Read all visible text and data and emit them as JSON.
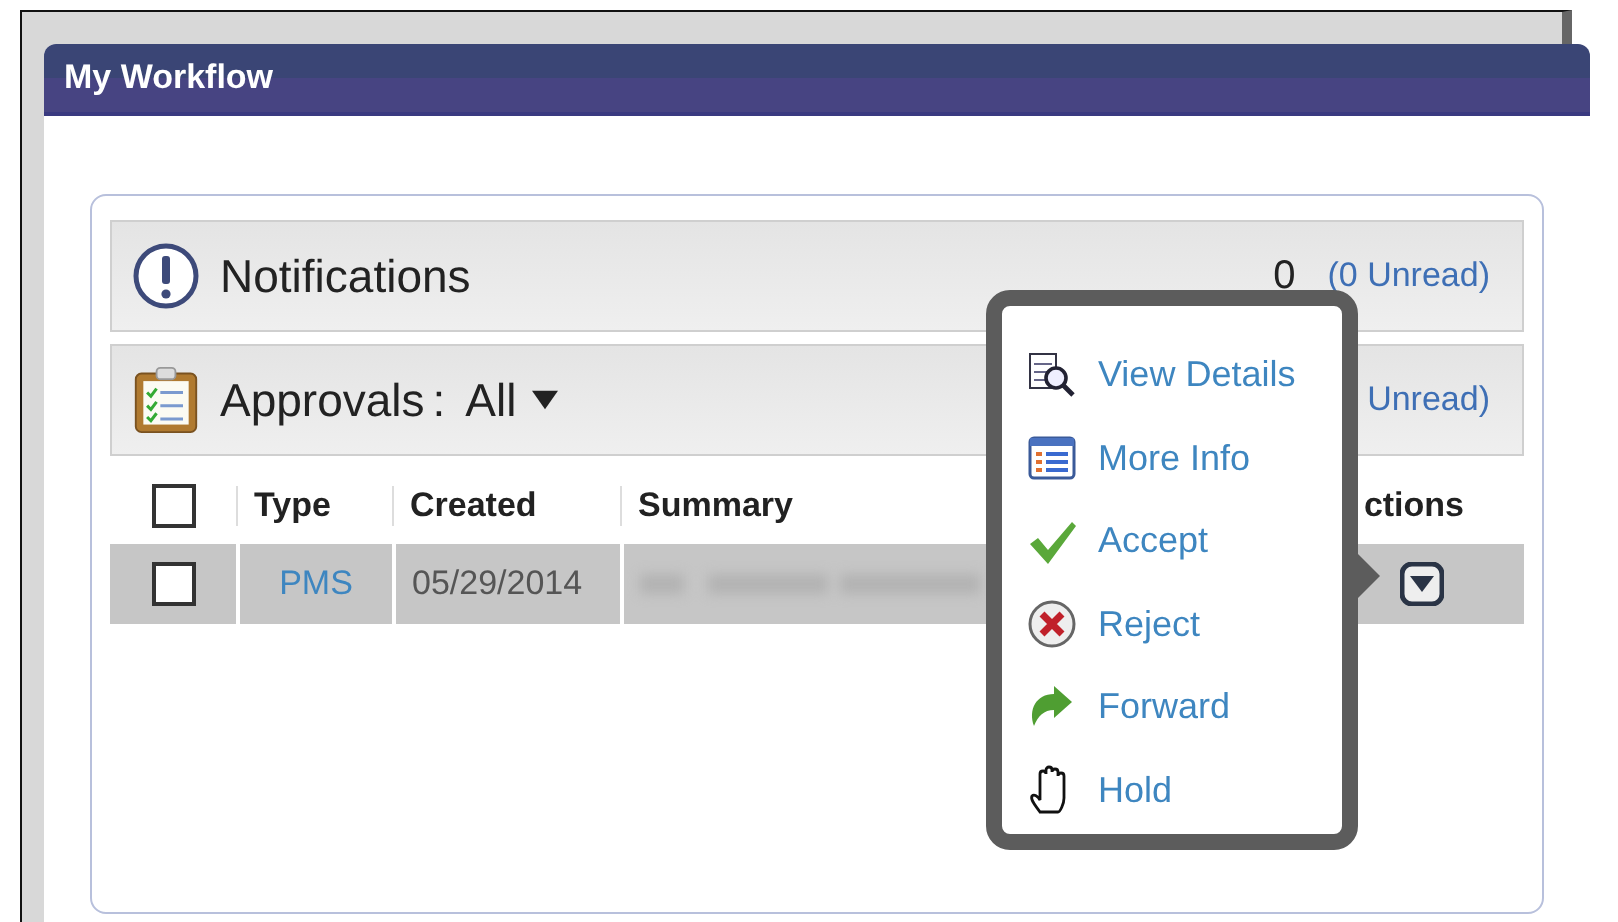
{
  "window": {
    "title": "My Workflow"
  },
  "sections": [
    {
      "kind": "notifications",
      "label": "Notifications",
      "count": "0",
      "unread": "(0 Unread)"
    },
    {
      "kind": "approvals",
      "label": "Approvals",
      "separator": ":",
      "filter": "All",
      "unread": "Unread)"
    }
  ],
  "table": {
    "select_all": {
      "checked": false
    },
    "columns": [
      "Type",
      "Created",
      "Summary",
      "ctions"
    ],
    "rows": [
      {
        "checked": false,
        "selected": true,
        "type": "PMS",
        "created": "05/29/2014"
      }
    ]
  },
  "menu": {
    "items": [
      {
        "kind": "view",
        "label": "View Details"
      },
      {
        "kind": "info",
        "label": "More Info"
      },
      {
        "kind": "accept",
        "label": "Accept"
      },
      {
        "kind": "reject",
        "label": "Reject"
      },
      {
        "kind": "forward",
        "label": "Forward"
      },
      {
        "kind": "hold",
        "label": "Hold"
      }
    ]
  }
}
